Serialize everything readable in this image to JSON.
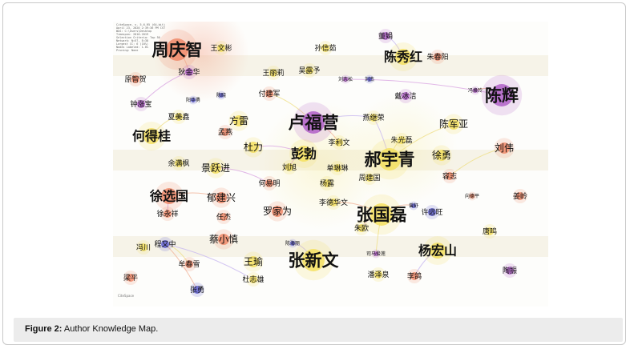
{
  "caption": {
    "label": "Figure 2:",
    "text": " Author Knowledge Map."
  },
  "map": {
    "legend_lines": [
      "CiteSpace, v. 5.6.R5 (64-bit)",
      "April 23, 2020 2:39:36 PM CST",
      "WoS: C:\\Users\\Desktop",
      "Timespan: 2010-2019",
      "Selection Criteria: Top 50",
      "Network: N=57, E=38",
      "Largest CC: 6 (10%)",
      "Nodes Labeled: 1.0%",
      "Pruning: None"
    ],
    "watermark": "CiteSpace",
    "nodes": [
      {
        "label": "周庆智",
        "size": "xl",
        "color": "#f08a6a"
      },
      {
        "label": "王文彬",
        "size": "s",
        "color": "#f5e060"
      },
      {
        "label": "孙信茹",
        "size": "s",
        "color": "#f5e060"
      },
      {
        "label": "董娟",
        "size": "s",
        "color": "#b060c8"
      },
      {
        "label": "陈秀红",
        "size": "l",
        "color": "#f5e060"
      },
      {
        "label": "朱春阳",
        "size": "s",
        "color": "#f08a6a"
      },
      {
        "label": "狄金华",
        "size": "s",
        "color": "#b060c8"
      },
      {
        "label": "原智贺",
        "size": "s",
        "color": "#f08a6a"
      },
      {
        "label": "王丽莉",
        "size": "s",
        "color": "#f5e060"
      },
      {
        "label": "吴露予",
        "size": "s",
        "color": "#f5e060"
      },
      {
        "label": "刘杰",
        "size": "xs",
        "color": "#6060d0"
      },
      {
        "label": "刘志松",
        "size": "xs",
        "color": "#b060c8"
      },
      {
        "label": "陈辉",
        "size": "xl",
        "color": "#b060c8"
      },
      {
        "label": "付建军",
        "size": "s",
        "color": "#f08a6a"
      },
      {
        "label": "戴冰洁",
        "size": "s",
        "color": "#b060c8"
      },
      {
        "label": "钟涨宝",
        "size": "s",
        "color": "#b060c8"
      },
      {
        "label": "陈晓",
        "size": "xs",
        "color": "#6060d0"
      },
      {
        "label": "阳华勇",
        "size": "xs",
        "color": "#6060d0"
      },
      {
        "label": "冯焕玲",
        "size": "xs",
        "color": "#b060c8"
      },
      {
        "label": "夏美鑫",
        "size": "s",
        "color": "#f5e060"
      },
      {
        "label": "方雷",
        "size": "m",
        "color": "#f5e060"
      },
      {
        "label": "卢福营",
        "size": "xl",
        "color": "#b060c8"
      },
      {
        "label": "燕继荣",
        "size": "s",
        "color": "#f5e060"
      },
      {
        "label": "陈军亚",
        "size": "m",
        "color": "#f5e060"
      },
      {
        "label": "何得桂",
        "size": "l",
        "color": "#f5e060"
      },
      {
        "label": "孟燕",
        "size": "s",
        "color": "#f08a6a"
      },
      {
        "label": "李利文",
        "size": "s",
        "color": "#f5e060"
      },
      {
        "label": "朱光磊",
        "size": "s",
        "color": "#f5e060"
      },
      {
        "label": "刘伟",
        "size": "m",
        "color": "#f08a6a"
      },
      {
        "label": "杜力",
        "size": "m",
        "color": "#f5e060"
      },
      {
        "label": "彭勃",
        "size": "l",
        "color": "#f5e060"
      },
      {
        "label": "郝宇青",
        "size": "xl",
        "color": "#f5e060"
      },
      {
        "label": "徐勇",
        "size": "m",
        "color": "#f5e060"
      },
      {
        "label": "余满枫",
        "size": "s",
        "color": "#f5e060"
      },
      {
        "label": "景跃进",
        "size": "m",
        "color": "#f5e060"
      },
      {
        "label": "刘旭",
        "size": "s",
        "color": "#f5e060"
      },
      {
        "label": "单琳琳",
        "size": "s",
        "color": "#f5e060"
      },
      {
        "label": "何易明",
        "size": "s",
        "color": "#f08a6a"
      },
      {
        "label": "杨露",
        "size": "s",
        "color": "#f5e060"
      },
      {
        "label": "周建国",
        "size": "s",
        "color": "#f5e060"
      },
      {
        "label": "容志",
        "size": "s",
        "color": "#f08a6a"
      },
      {
        "label": "徐选国",
        "size": "l",
        "color": "#f08a6a"
      },
      {
        "label": "郁建兴",
        "size": "m",
        "color": "#f08a6a"
      },
      {
        "label": "李德华文",
        "size": "s",
        "color": "#f5e060"
      },
      {
        "label": "张国磊",
        "size": "xl",
        "color": "#f5e060"
      },
      {
        "label": "向德平",
        "size": "xs",
        "color": "#f08a6a"
      },
      {
        "label": "姜岭",
        "size": "s",
        "color": "#f08a6a"
      },
      {
        "label": "徐永祥",
        "size": "s",
        "color": "#f08a6a"
      },
      {
        "label": "罗家为",
        "size": "m",
        "color": "#f08a6a"
      },
      {
        "label": "任杰",
        "size": "s",
        "color": "#f08a6a"
      },
      {
        "label": "许远旺",
        "size": "s",
        "color": "#6060d0"
      },
      {
        "label": "曾舒",
        "size": "xs",
        "color": "#6060d0"
      },
      {
        "label": "朱欧",
        "size": "s",
        "color": "#f5e060"
      },
      {
        "label": "唐鸣",
        "size": "s",
        "color": "#f5e060"
      },
      {
        "label": "蔡小慎",
        "size": "m",
        "color": "#f08a6a"
      },
      {
        "label": "冯川",
        "size": "s",
        "color": "#f5e060"
      },
      {
        "label": "程又中",
        "size": "s",
        "color": "#6060d0"
      },
      {
        "label": "陈海丽",
        "size": "xs",
        "color": "#6060d0"
      },
      {
        "label": "杨宏山",
        "size": "l",
        "color": "#f5e060"
      },
      {
        "label": "司马俊莲",
        "size": "xs",
        "color": "#b060c8"
      },
      {
        "label": "王瑜",
        "size": "m",
        "color": "#f5e060"
      },
      {
        "label": "张新文",
        "size": "xl",
        "color": "#f5e060"
      },
      {
        "label": "牟春雪",
        "size": "s",
        "color": "#f08a6a"
      },
      {
        "label": "陶振",
        "size": "s",
        "color": "#b060c8"
      },
      {
        "label": "梁平",
        "size": "s",
        "color": "#f08a6a"
      },
      {
        "label": "杜志雄",
        "size": "s",
        "color": "#f5e060"
      },
      {
        "label": "潘泽泉",
        "size": "s",
        "color": "#f5e060"
      },
      {
        "label": "李鸽",
        "size": "s",
        "color": "#f08a6a"
      },
      {
        "label": "张勇",
        "size": "s",
        "color": "#6060d0"
      }
    ]
  }
}
